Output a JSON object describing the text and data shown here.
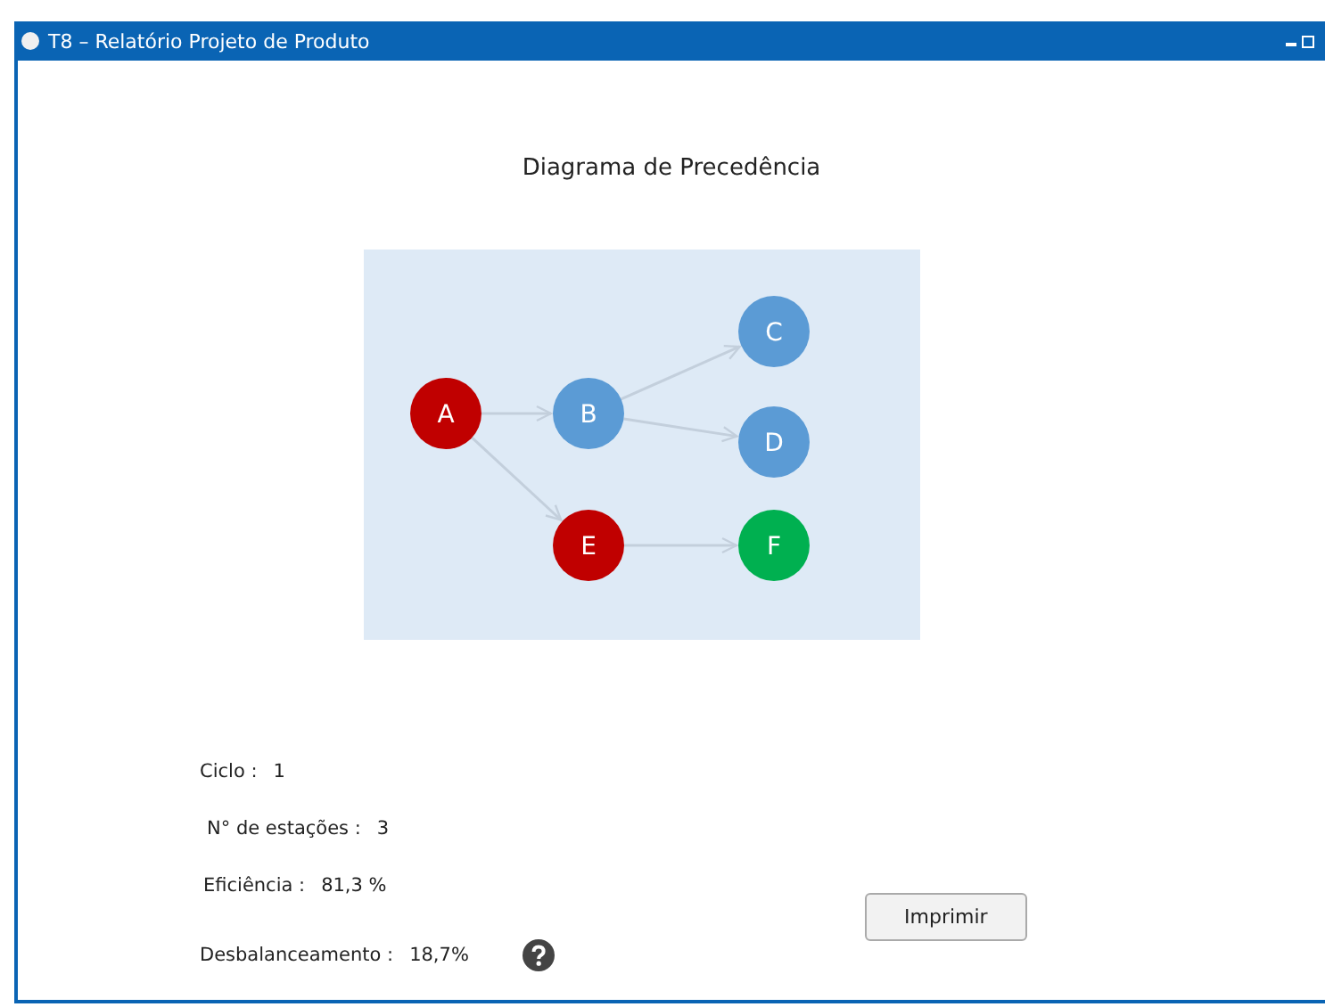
{
  "window": {
    "title": "T8 – Relatório Projeto de Produto"
  },
  "diagram": {
    "title": "Diagrama de Precedência",
    "nodes": [
      {
        "label": "A",
        "color": "#c00000"
      },
      {
        "label": "B",
        "color": "#5b9bd5"
      },
      {
        "label": "C",
        "color": "#5b9bd5"
      },
      {
        "label": "D",
        "color": "#5b9bd5"
      },
      {
        "label": "E",
        "color": "#c00000"
      },
      {
        "label": "F",
        "color": "#00b050"
      }
    ]
  },
  "stats": [
    {
      "label": "Ciclo :",
      "value": "1"
    },
    {
      "label": "N° de estações :",
      "value": "3"
    },
    {
      "label": "Eficiência :",
      "value": "81,3 %"
    },
    {
      "label": "Desbalanceamento :",
      "value": "18,7%",
      "help": true
    }
  ],
  "buttons": [
    {
      "label": "Imprimir"
    }
  ]
}
